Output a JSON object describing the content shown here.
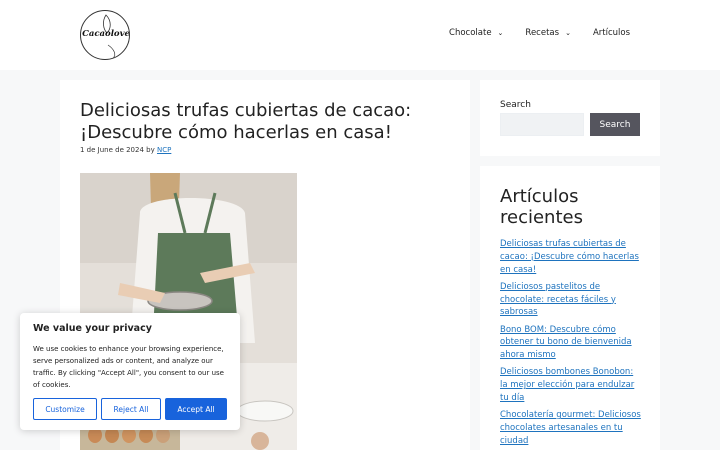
{
  "header": {
    "logo_text": "Cacaolove",
    "nav": [
      {
        "label": "Chocolate",
        "has_dropdown": true
      },
      {
        "label": "Recetas",
        "has_dropdown": true
      },
      {
        "label": "Artículos",
        "has_dropdown": false
      }
    ]
  },
  "article": {
    "title": "Deliciosas trufas cubiertas de cacao: ¡Descubre cómo hacerlas en casa!",
    "date": "1 de June de 2024",
    "by": "by",
    "author": "NCP"
  },
  "search": {
    "label": "Search",
    "button": "Search",
    "input_value": ""
  },
  "recent": {
    "title": "Artículos recientes",
    "items": [
      "Deliciosas trufas cubiertas de cacao: ¡Descubre cómo hacerlas en casa!",
      "Deliciosos pastelitos de chocolate: recetas fáciles y sabrosas",
      "Bono BOM: Descubre cómo obtener tu bono de bienvenida ahora mismo",
      "Deliciosos bombones Bonobon: la mejor elección para endulzar tu día",
      "Chocolatería gourmet: Deliciosos chocolates artesanales en tu ciudad"
    ]
  },
  "cookie": {
    "title": "We value your privacy",
    "text": "We use cookies to enhance your browsing experience, serve personalized ads or content, and analyze our traffic. By clicking \"Accept All\", you consent to our use of cookies.",
    "customize": "Customize",
    "reject": "Reject All",
    "accept": "Accept All"
  },
  "colors": {
    "link": "#1e73be",
    "search_button": "#55555e",
    "cookie_accent": "#1863dc"
  }
}
